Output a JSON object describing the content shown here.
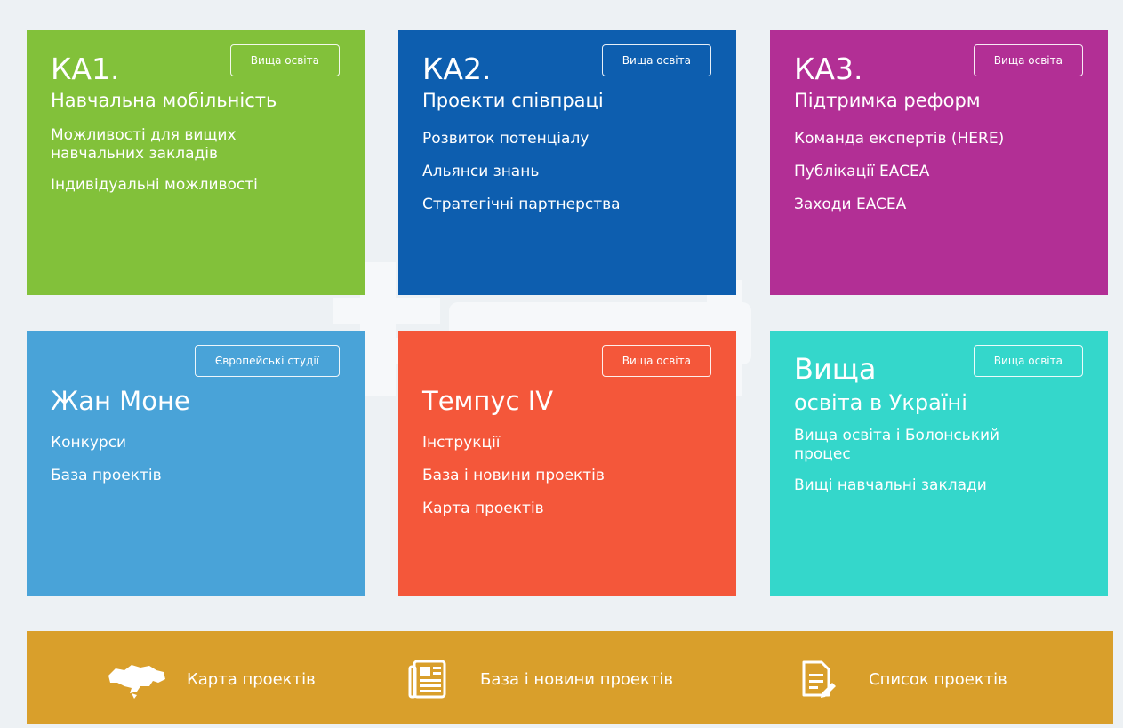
{
  "colors": {
    "ka1": "#82c13a",
    "ka2": "#0d5eaf",
    "ka3": "#b22f95",
    "jean_monnet": "#49a3d8",
    "tempus": "#f4573a",
    "higher_ed": "#34d7cb",
    "bottom_bar": "#d99f2b",
    "background": "#edf1f4"
  },
  "tiles": [
    {
      "code": "КА1.",
      "title": "Навчальна мобільність",
      "badge": "Вища освіта",
      "links": [
        "Можливості для вищих",
        "навчальних закладів",
        "Індивідуальні можливості"
      ]
    },
    {
      "code": "КА2.",
      "title": "Проекти співпраці",
      "badge": "Вища освіта",
      "links": [
        "Розвиток потенціалу",
        "Альянси знань",
        "Стратегічні партнерства"
      ]
    },
    {
      "code": "КА3.",
      "title": "Підтримка реформ",
      "badge": "Вища освіта",
      "links": [
        "Команда експертів (HERE)",
        "Публікації EACEA",
        "Заходи EACEA"
      ]
    },
    {
      "title": "Жан Моне",
      "badge": "Європейські студії",
      "links": [
        "Конкурси",
        "База проектів"
      ]
    },
    {
      "title": "Темпус IV",
      "badge": "Вища освіта",
      "links": [
        "Інструкції",
        "База і новини проектів",
        "Карта проектів"
      ]
    },
    {
      "title": "Вища",
      "subtitle": "освіта в Україні",
      "badge": "Вища освіта",
      "links": [
        "Вища освіта і Болонський",
        "процес",
        "Вищі навчальні заклади"
      ]
    }
  ],
  "bottom_bar": {
    "items": [
      {
        "icon": "ukraine-map-icon",
        "label": "Карта проектів"
      },
      {
        "icon": "newspaper-icon",
        "label": "База і новини проектів"
      },
      {
        "icon": "document-list-icon",
        "label": "Список проектів"
      }
    ]
  }
}
